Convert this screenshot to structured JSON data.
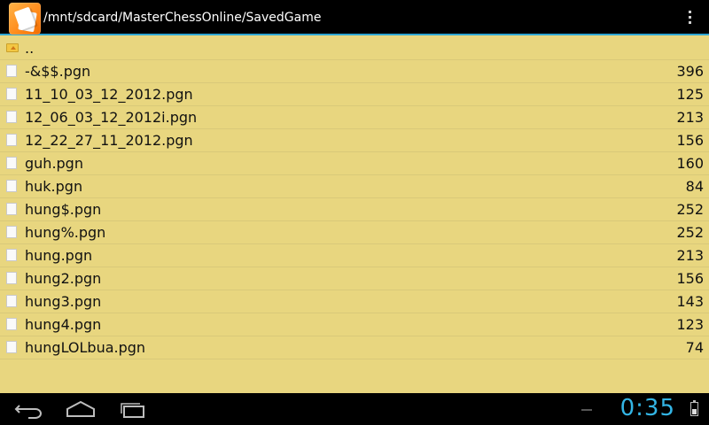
{
  "header": {
    "path": "/mnt/sdcard/MasterChessOnline/SavedGame",
    "app_icon": "chess-app-icon",
    "menu_icon": "overflow-menu-icon"
  },
  "parent": {
    "label": ".."
  },
  "files": [
    {
      "name": "-&$$.pgn",
      "size": "396"
    },
    {
      "name": "11_10_03_12_2012.pgn",
      "size": "125"
    },
    {
      "name": "12_06_03_12_2012i.pgn",
      "size": "213"
    },
    {
      "name": "12_22_27_11_2012.pgn",
      "size": "156"
    },
    {
      "name": "guh.pgn",
      "size": "160"
    },
    {
      "name": "huk.pgn",
      "size": "84"
    },
    {
      "name": "hung$.pgn",
      "size": "252"
    },
    {
      "name": "hung%.pgn",
      "size": "252"
    },
    {
      "name": "hung.pgn",
      "size": "213"
    },
    {
      "name": "hung2.pgn",
      "size": "156"
    },
    {
      "name": "hung3.pgn",
      "size": "143"
    },
    {
      "name": "hung4.pgn",
      "size": "123"
    },
    {
      "name": "hungLOLbua.pgn",
      "size": "74"
    }
  ],
  "system": {
    "time": "0:35"
  },
  "colors": {
    "list_bg": "#e8d67f",
    "accent": "#33b5e5",
    "bar_bg": "#000000"
  }
}
